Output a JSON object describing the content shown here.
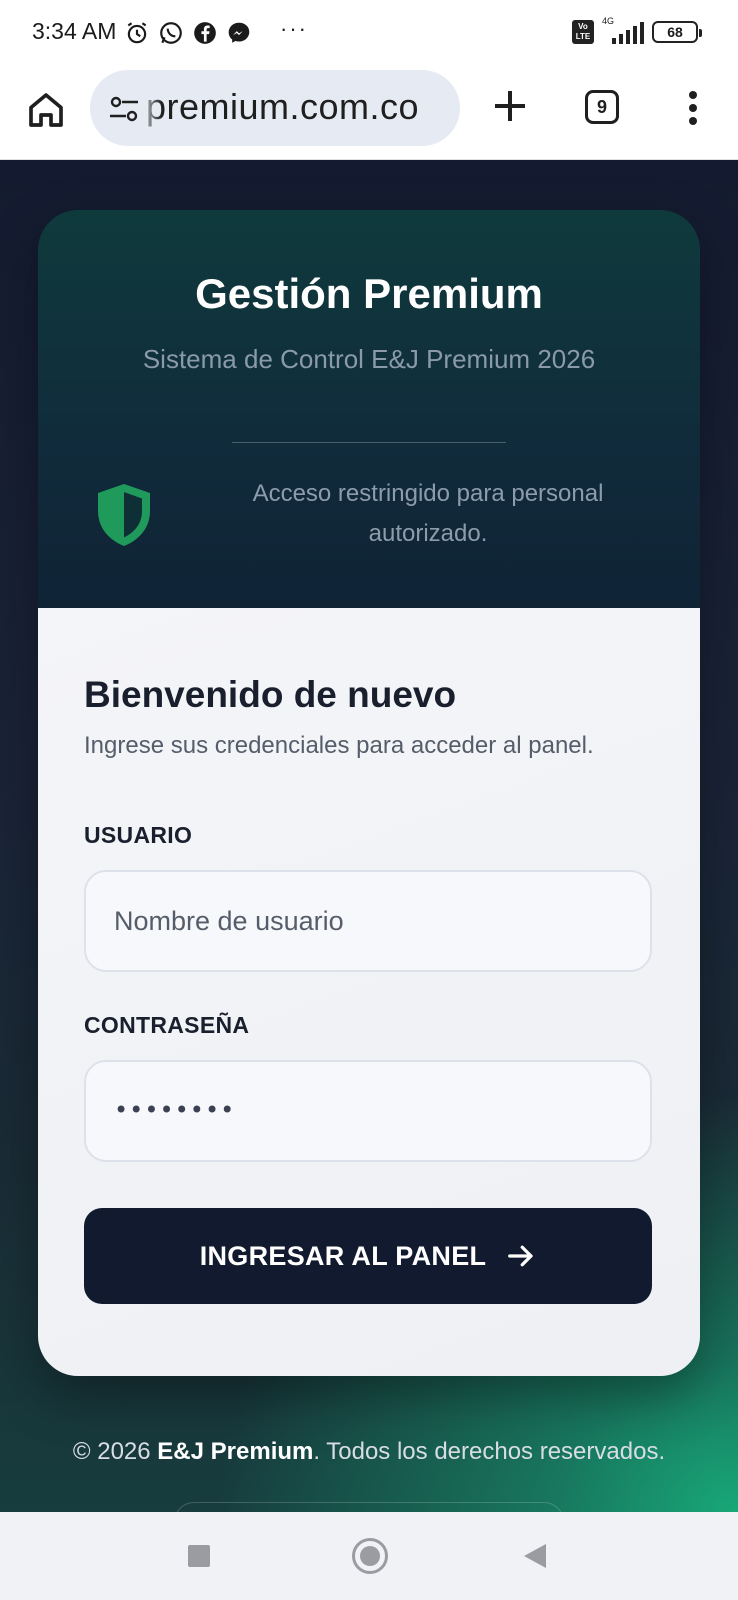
{
  "status_bar": {
    "time": "3:34 AM",
    "network": "4G",
    "volte": "Vo LTE",
    "battery": "68"
  },
  "browser": {
    "url": "premium.com.co",
    "tab_count": "9",
    "icons": [
      "home-icon",
      "site-settings-icon",
      "plus-icon",
      "tabs-icon",
      "more-vert-icon"
    ]
  },
  "brand": {
    "title": "Gestión Premium",
    "subtitle": "Sistema de Control E&J Premium 2026",
    "restricted_text": "Acceso restringido para personal autorizado.",
    "shield_color": "#1f9a5a"
  },
  "login": {
    "heading": "Bienvenido de nuevo",
    "subheading": "Ingrese sus credenciales para acceder al panel.",
    "user_label": "USUARIO",
    "user_placeholder": "Nombre de usuario",
    "password_label": "CONTRASEÑA",
    "password_value": "••••••••",
    "submit_label": "INGRESAR AL PANEL",
    "submit_color": "#111a2e"
  },
  "footer": {
    "prefix": "© 2026 ",
    "brand": "E&J Premium",
    "suffix": ". Todos los derechos reservados."
  },
  "colors": {
    "accent_green": "#18a878",
    "page_dark": "#141b30"
  }
}
